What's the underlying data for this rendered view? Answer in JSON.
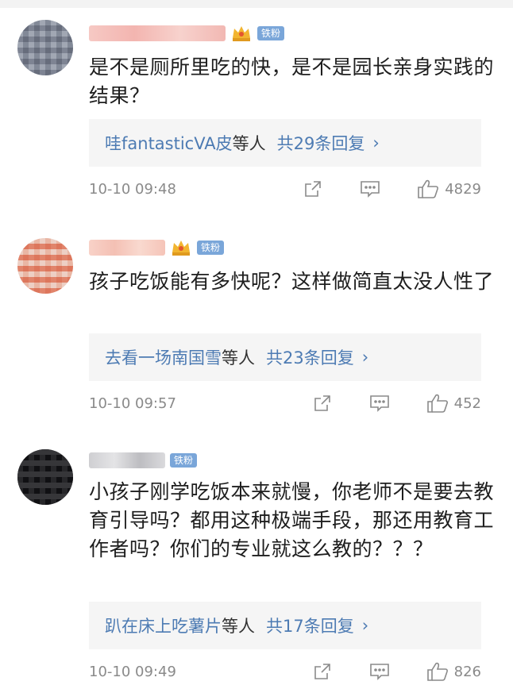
{
  "comments": [
    {
      "badge": "铁粉",
      "text": "是不是厕所里吃的快，是不是园长亲身实践的结果？",
      "reply_names": "哇fantasticVA皮",
      "reply_mid": "等人",
      "reply_count": "共29条回复",
      "reply_arrow": "›",
      "time": "10-10 09:48",
      "likes": "4829"
    },
    {
      "badge": "铁粉",
      "text": "孩子吃饭能有多快呢？这样做简直太没人性了",
      "reply_names": "去看一场南国雪",
      "reply_mid": "等人",
      "reply_count": "共23条回复",
      "reply_arrow": "›",
      "time": "10-10 09:57",
      "likes": "452"
    },
    {
      "badge": "铁粉",
      "text": "小孩子刚学吃饭本来就慢，你老师不是要去教育引导吗？都用这种极端手段，那还用教育工作者吗？你们的专业就这么教的？？？",
      "reply_names": "趴在床上吃薯片",
      "reply_mid": "等人",
      "reply_count": "共17条回复",
      "reply_arrow": "›",
      "time": "10-10 09:49",
      "likes": "826"
    }
  ],
  "colors": {
    "link": "#4d7bb3",
    "badge": "#7aa6d9",
    "reply_bg": "#f5f5f5",
    "meta": "#8a8a8a"
  },
  "icons": {
    "share": "share-icon",
    "comment": "comment-icon",
    "like": "thumbs-up-icon",
    "crown": "crown-icon"
  }
}
